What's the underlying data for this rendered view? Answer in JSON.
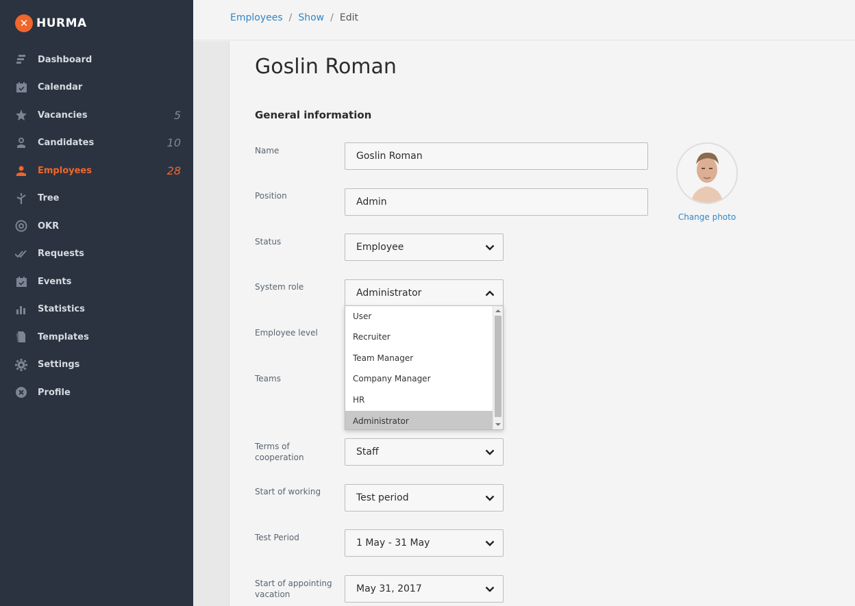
{
  "brand": {
    "name": "HURMA",
    "accent": "#f0662b"
  },
  "sidebar": {
    "items": [
      {
        "label": "Dashboard",
        "icon": "dashboard-icon",
        "count": ""
      },
      {
        "label": "Calendar",
        "icon": "calendar-icon",
        "count": ""
      },
      {
        "label": "Vacancies",
        "icon": "star-icon",
        "count": "5"
      },
      {
        "label": "Candidates",
        "icon": "candidate-icon",
        "count": "10"
      },
      {
        "label": "Employees",
        "icon": "employee-icon",
        "count": "28",
        "active": true
      },
      {
        "label": "Tree",
        "icon": "tree-icon",
        "count": ""
      },
      {
        "label": "OKR",
        "icon": "target-icon",
        "count": ""
      },
      {
        "label": "Requests",
        "icon": "requests-icon",
        "count": ""
      },
      {
        "label": "Events",
        "icon": "events-icon",
        "count": ""
      },
      {
        "label": "Statistics",
        "icon": "statistics-icon",
        "count": ""
      },
      {
        "label": "Templates",
        "icon": "templates-icon",
        "count": ""
      },
      {
        "label": "Settings",
        "icon": "gear-icon",
        "count": ""
      },
      {
        "label": "Profile",
        "icon": "profile-icon",
        "count": ""
      }
    ]
  },
  "breadcrumb": {
    "employees": "Employees",
    "show": "Show",
    "edit": "Edit",
    "sep": "/"
  },
  "page": {
    "title": "Goslin Roman",
    "section": "General information"
  },
  "form": {
    "name": {
      "label": "Name",
      "value": "Goslin Roman"
    },
    "position": {
      "label": "Position",
      "value": "Admin"
    },
    "status": {
      "label": "Status",
      "value": "Employee"
    },
    "system_role": {
      "label": "System role",
      "value": "Administrator",
      "options": [
        "User",
        "Recruiter",
        "Team Manager",
        "Company Manager",
        "HR",
        "Administrator"
      ]
    },
    "employee_level": {
      "label": "Employee level"
    },
    "teams": {
      "label": "Teams"
    },
    "terms": {
      "label": "Terms of cooperation",
      "value": "Staff"
    },
    "start_working": {
      "label": "Start of working",
      "value": "Test period"
    },
    "test_period": {
      "label": "Test Period",
      "value": "1 May - 31 May"
    },
    "vacation": {
      "label": "Start of appointing vacation",
      "value": "May 31, 2017"
    }
  },
  "photo": {
    "change_label": "Change photo"
  }
}
